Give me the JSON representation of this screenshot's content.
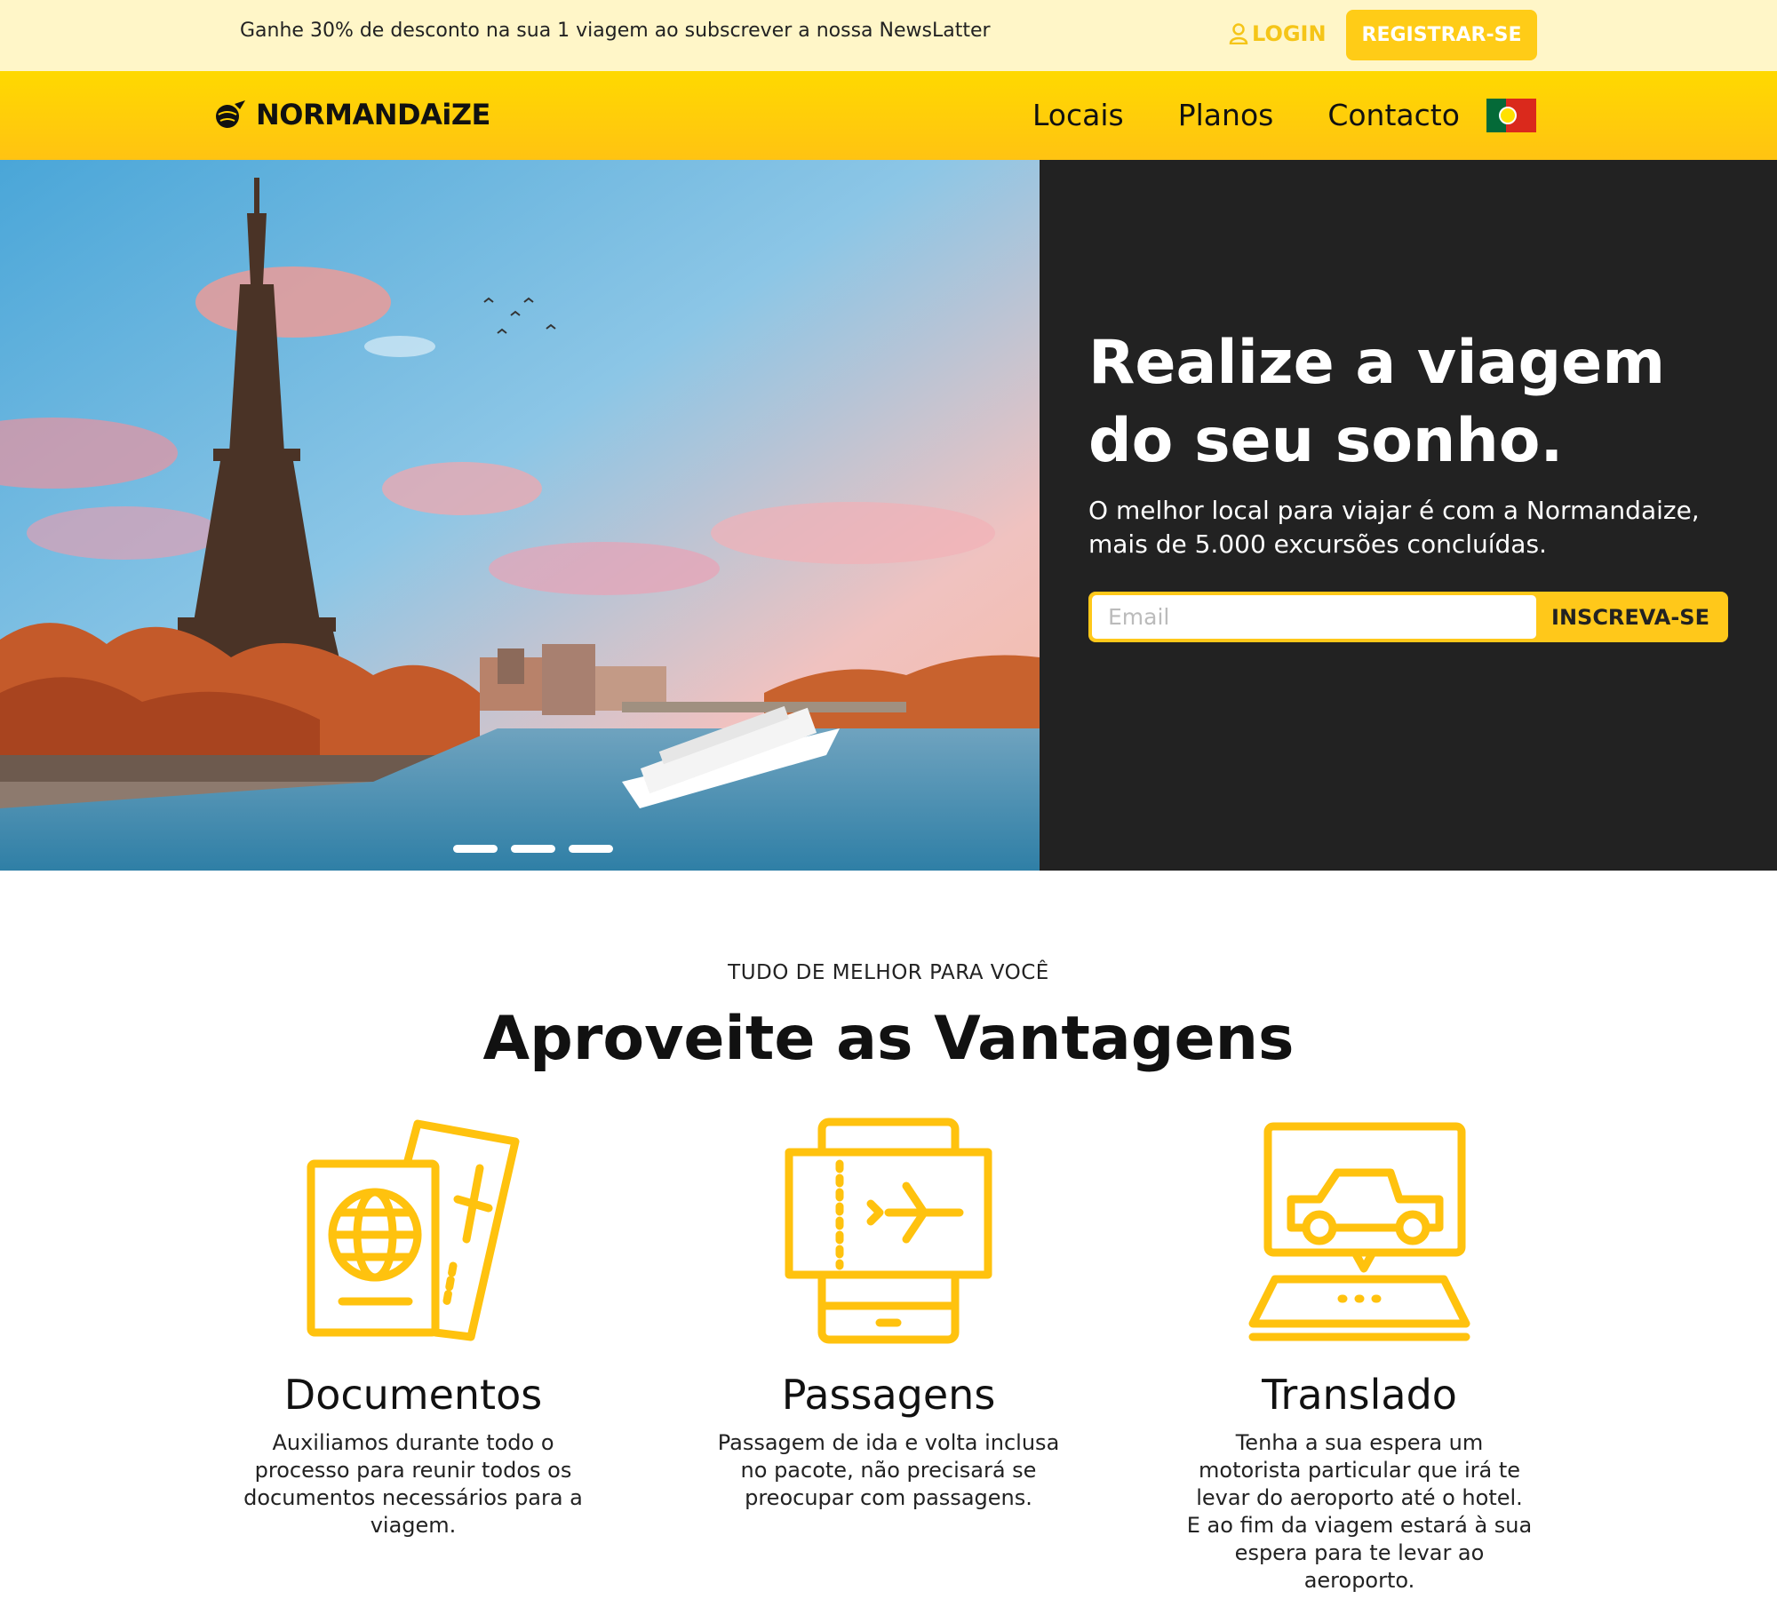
{
  "topbar": {
    "promo": "Ganhe 30% de desconto na sua 1 viagem ao subscrever a nossa NewsLatter",
    "login": "LOGIN",
    "register": "REGISTRAR-SE"
  },
  "brand": {
    "name": "NORMANDAiZE"
  },
  "nav": {
    "items": [
      "Locais",
      "Planos",
      "Contacto"
    ],
    "language_flag": "portugal-flag-icon"
  },
  "hero": {
    "title": "Realize a viagem do seu sonho.",
    "subtitle": "O melhor local para viajar é com a Normandaize, mais de 5.000 excursões concluídas.",
    "email_placeholder": "Email",
    "email_value": "",
    "subscribe_button": "INSCREVA-SE",
    "carousel_slides": 3
  },
  "advantages": {
    "overline": "TUDO DE MELHOR PARA VOCÊ",
    "title": "Aproveite as Vantagens",
    "items": [
      {
        "icon": "passport-ticket-icon",
        "title": "Documentos",
        "text": "Auxiliamos durante todo o processo para reunir todos os documentos necessários para a viagem."
      },
      {
        "icon": "mobile-boarding-pass-icon",
        "title": "Passagens",
        "text": "Passagem de ida e volta inclusa no pacote, não precisará se preocupar com passagens."
      },
      {
        "icon": "car-map-icon",
        "title": "Translado",
        "text": "Tenha a sua espera um motorista particular que irá te levar do aeroporto até o hotel. E ao fim da viagem estará à sua espera para te levar ao aeroporto."
      }
    ]
  },
  "colors": {
    "accent": "#ffc81a",
    "promo_bg": "#fff6c8",
    "hero_panel": "#222222",
    "icon_stroke": "#ffc20e"
  }
}
